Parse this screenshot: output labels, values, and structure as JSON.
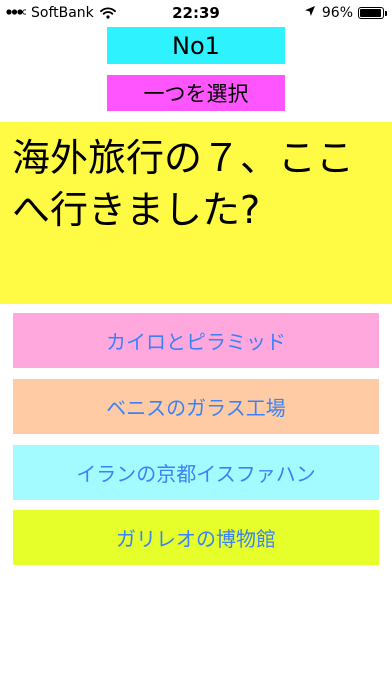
{
  "status_bar": {
    "carrier": "SoftBank",
    "time": "22:39",
    "battery_percent": "96%",
    "battery_level": 0.96,
    "icons": [
      "signal-icon",
      "wifi-icon",
      "location-arrow-icon",
      "battery-icon"
    ]
  },
  "quiz": {
    "number_label": "No1",
    "mode_label": "一つを選択",
    "question": "海外旅行の７、ここへ行きました?"
  },
  "choices": [
    {
      "label": "カイロとピラミッド"
    },
    {
      "label": "ベニスのガラス工場"
    },
    {
      "label": "イランの京都イスファハン"
    },
    {
      "label": "ガリレオの博物館"
    }
  ],
  "colors": {
    "no_label_bg": "#2FF2FF",
    "mode_label_bg": "#FF55FF",
    "question_bg": "#FFFA44",
    "choice_text": "#3B82F6",
    "choice_bgs": [
      "#FFA8DD",
      "#FFCBA4",
      "#A4FBFF",
      "#E6FF2A"
    ]
  }
}
